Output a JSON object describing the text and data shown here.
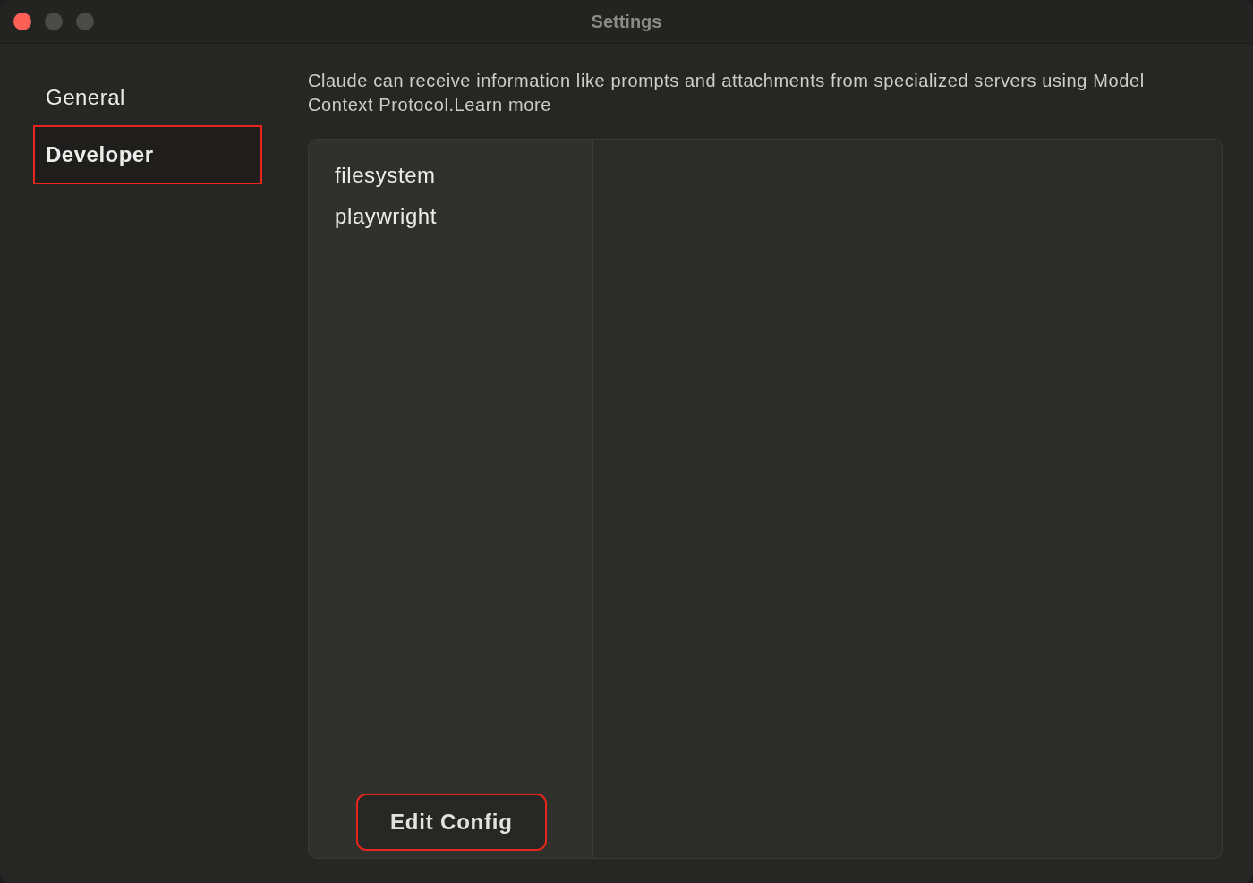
{
  "window": {
    "title": "Settings"
  },
  "sidebar": {
    "items": [
      {
        "label": "General",
        "selected": false,
        "highlighted": false
      },
      {
        "label": "Developer",
        "selected": true,
        "highlighted": true
      }
    ]
  },
  "description": {
    "text": "Claude can receive information like prompts and attachments from specialized servers using Model Context Protocol.",
    "link": "Learn more"
  },
  "servers": [
    {
      "name": "filesystem"
    },
    {
      "name": "playwright"
    }
  ],
  "edit_button": {
    "label": "Edit Config",
    "highlighted": true
  }
}
